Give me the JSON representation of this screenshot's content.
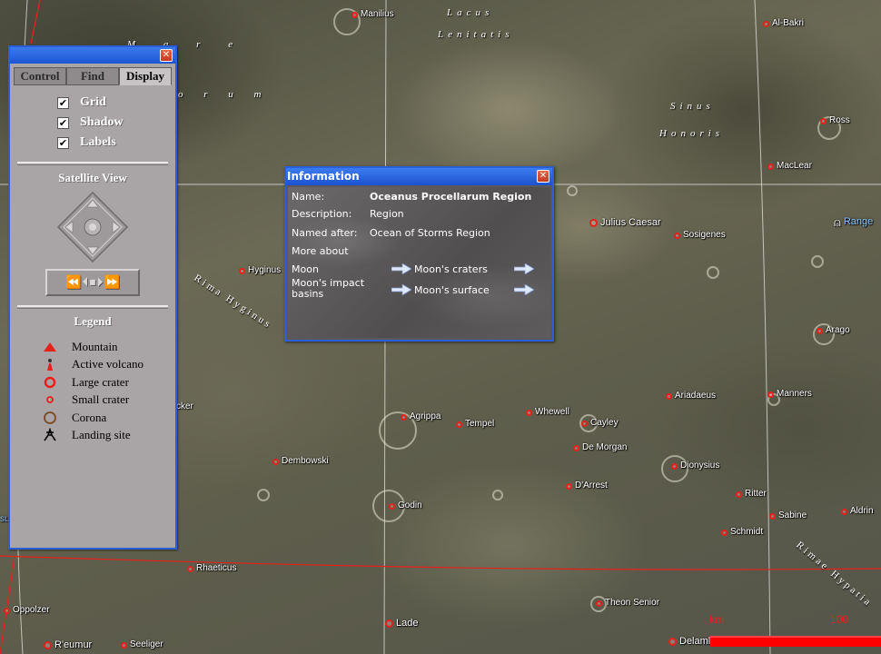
{
  "map": {
    "regions": [
      {
        "id": "lacus-lenitatis-1",
        "text": "Lacus"
      },
      {
        "id": "lacus-lenitatis-2",
        "text": "Lenitatis"
      },
      {
        "id": "sinus-honoris-1",
        "text": "Sinus"
      },
      {
        "id": "sinus-honoris-2",
        "text": "Honoris"
      },
      {
        "id": "mare-1",
        "text": "M a r e"
      },
      {
        "id": "mare-2",
        "text": "o r u m"
      }
    ],
    "rilles": [
      {
        "id": "rima-hyginus",
        "text": "Rima Hyginus"
      },
      {
        "id": "rima-hypatia",
        "text": "Rimae Hypatia"
      }
    ],
    "features": [
      {
        "name": "Manilius",
        "big": false
      },
      {
        "name": "Al-Bakri",
        "big": false
      },
      {
        "name": "Ross",
        "big": false
      },
      {
        "name": "MacLear",
        "big": false
      },
      {
        "name": "Julius Caesar",
        "big": true
      },
      {
        "name": "Sosigenes",
        "big": false
      },
      {
        "name": "Hyginus",
        "big": false
      },
      {
        "name": "Arago",
        "big": false
      },
      {
        "name": "Ariadaeus",
        "big": false
      },
      {
        "name": "Manners",
        "big": false
      },
      {
        "name": "Agrippa",
        "big": false
      },
      {
        "name": "Tempel",
        "big": false
      },
      {
        "name": "Whewell",
        "big": false
      },
      {
        "name": "Cayley",
        "big": false
      },
      {
        "name": "De Morgan",
        "big": false
      },
      {
        "name": "Dionysius",
        "big": false
      },
      {
        "name": "Dembowski",
        "big": false
      },
      {
        "name": "D'Arrest",
        "big": false
      },
      {
        "name": "Ritter",
        "big": false
      },
      {
        "name": "Godin",
        "big": false
      },
      {
        "name": "Sabine",
        "big": false
      },
      {
        "name": "Aldrin",
        "big": false
      },
      {
        "name": "Schmidt",
        "big": false
      },
      {
        "name": "Rhaeticus",
        "big": false
      },
      {
        "name": "Theon Senior",
        "big": false
      },
      {
        "name": "Oppolzer",
        "big": false
      },
      {
        "name": "Lade",
        "big": true
      },
      {
        "name": "R'eumur",
        "big": true
      },
      {
        "name": "Seeliger",
        "big": false
      },
      {
        "name": "Delaml",
        "big": true
      }
    ],
    "partial_labels": {
      "cker": "cker",
      "su": "su"
    },
    "landing_site": "Range",
    "scale": {
      "unit": "km",
      "max": "100"
    }
  },
  "panel": {
    "close": "✕",
    "tabs": [
      "Control",
      "Find",
      "Display"
    ],
    "active_tab": "Display",
    "checkboxes": [
      {
        "label": "Grid",
        "checked": true
      },
      {
        "label": "Shadow",
        "checked": true
      },
      {
        "label": "Labels",
        "checked": true
      }
    ],
    "satellite_view_title": "Satellite View",
    "legend_title": "Legend",
    "legend": [
      {
        "icon": "mountain-icon",
        "label": "Mountain",
        "color": "#e8201c"
      },
      {
        "icon": "volcano-icon",
        "label": "Active volcano",
        "color": "#e8201c"
      },
      {
        "icon": "large-crater-icon",
        "label": "Large crater",
        "color": "#e8201c"
      },
      {
        "icon": "small-crater-icon",
        "label": "Small crater",
        "color": "#e8201c"
      },
      {
        "icon": "corona-icon",
        "label": "Corona",
        "color": "#7a4a1a"
      },
      {
        "icon": "landing-site-icon",
        "label": "Landing site",
        "color": "#000000"
      }
    ],
    "playback": [
      "⏪",
      "⏴",
      "⏹",
      "⏵",
      "⏩"
    ]
  },
  "info": {
    "title": "Information",
    "close": "✕",
    "name_label": "Name:",
    "name_value": "Oceanus Procellarum Region",
    "description_label": "Description:",
    "description_value": "Region",
    "named_after_label": "Named after:",
    "named_after_value": "Ocean of Storms Region",
    "more_about": "More about",
    "links": [
      {
        "label": "Moon"
      },
      {
        "label": "Moon's craters"
      },
      {
        "label": "Moon's impact basins"
      },
      {
        "label": "Moon's surface"
      }
    ]
  },
  "colors": {
    "accent": "#2a5fd8",
    "marker": "#e8201c",
    "scale": "#ff0000"
  }
}
